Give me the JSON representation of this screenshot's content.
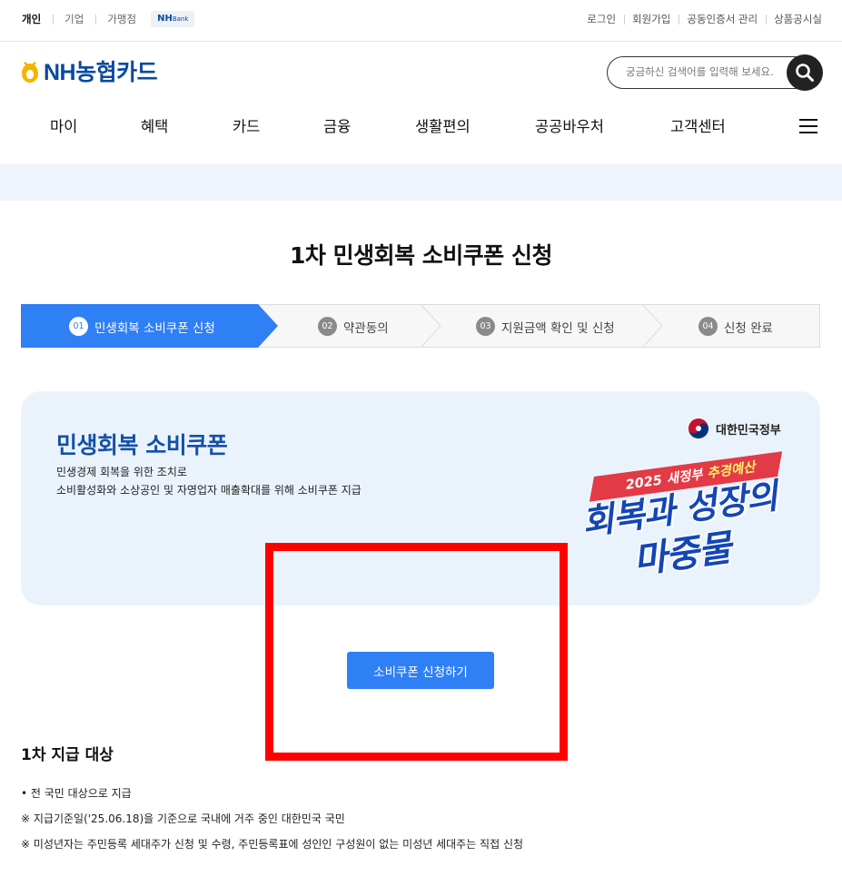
{
  "topbar": {
    "segments": [
      "개인",
      "기업",
      "가맹점"
    ],
    "nhbank_main": "NH",
    "nhbank_sub": "Bank",
    "util_links": [
      "로그인",
      "회원가입",
      "공동인증서 관리",
      "상품공시실"
    ]
  },
  "header": {
    "logo_text": "NH농협카드",
    "search_placeholder": "궁금하신 검색어를 입력해 보세요.",
    "nav": [
      "마이",
      "혜택",
      "카드",
      "금융",
      "생활편의",
      "공공바우처",
      "고객센터"
    ]
  },
  "page": {
    "title": "1차 민생회복 소비쿠폰 신청"
  },
  "steps": [
    {
      "num": "01",
      "label": "민생회복 소비쿠폰 신청",
      "active": true
    },
    {
      "num": "02",
      "label": "약관동의",
      "active": false
    },
    {
      "num": "03",
      "label": "지원금액 확인 및 신청",
      "active": false
    },
    {
      "num": "04",
      "label": "신청 완료",
      "active": false
    }
  ],
  "banner": {
    "title": "민생회복 소비쿠폰",
    "desc_line1": "민생경제 회복을 위한 조치로",
    "desc_line2": "소비활성화와 소상공인 및 자영업자 매출확대를 위해 소비쿠폰 지급",
    "gov_label": "대한민국정부",
    "ribbon_prefix": "2025 새정부 ",
    "ribbon_emph": "추경예산",
    "slogan_line1": "회복과 성장의",
    "slogan_line2": "마중물"
  },
  "apply_button": "소비쿠폰 신청하기",
  "target_section": {
    "title": "1차 지급 대상",
    "notes": [
      "• 전 국민 대상으로 지급",
      "※ 지급기준일('25.06.18)을 기준으로 국내에 거주 중인 대한민국 국민",
      "※ 미성년자는 주민등록 세대주가 신청 및 수령, 주민등록표에 성인인 구성원이 없는 미성년 세대주는 직접 신청"
    ]
  },
  "colors": {
    "brand_blue": "#0a4aa0",
    "accent_blue": "#2f7ff5",
    "highlight_red": "#ff0000",
    "banner_bg": "#eaf3fc"
  }
}
